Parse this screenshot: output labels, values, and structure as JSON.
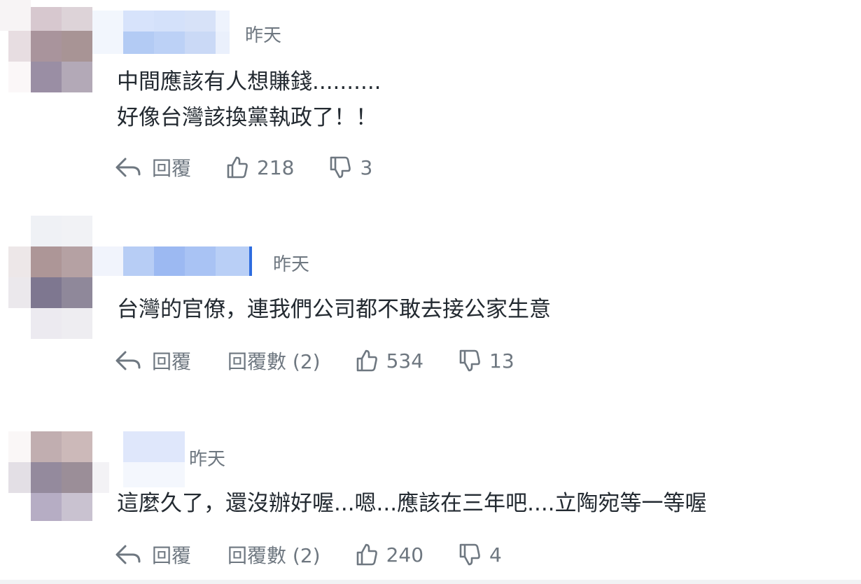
{
  "comments": [
    {
      "timestamp": "昨天",
      "lines": [
        "中間應該有人想賺錢..........",
        "好像台灣該換黨執政了！！"
      ],
      "reply_label": "回覆",
      "replies_count_label": "",
      "likes": "218",
      "dislikes": "3"
    },
    {
      "timestamp": "昨天",
      "lines": [
        "台灣的官僚，連我們公司都不敢去接公家生意"
      ],
      "reply_label": "回覆",
      "replies_count_label": "回覆數 (2)",
      "likes": "534",
      "dislikes": "13"
    },
    {
      "timestamp": "昨天",
      "lines": [
        "這麼久了，還沒辦好喔...嗯...應該在三年吧....立陶宛等一等喔"
      ],
      "reply_label": "回覆",
      "replies_count_label": "回覆數 (2)",
      "likes": "240",
      "dislikes": "4"
    }
  ],
  "icons": {
    "reply": "reply-arrow-icon",
    "like": "thumbs-up-icon",
    "dislike": "thumbs-down-icon"
  },
  "colors": {
    "meta_text": "#6e7780",
    "body_text": "#232a31"
  }
}
